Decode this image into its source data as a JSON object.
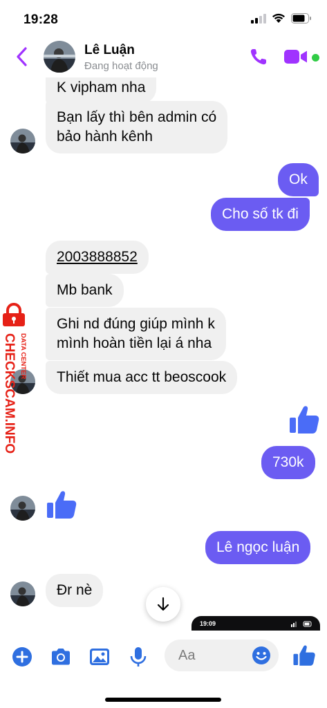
{
  "status_bar": {
    "time": "19:28"
  },
  "header": {
    "contact_name": "Lê Luận",
    "contact_status": "Đang hoạt động",
    "icons": [
      "back-chevron-icon",
      "phone-call-icon",
      "video-call-icon"
    ],
    "accent_color": "#a033ff"
  },
  "messages": {
    "in_1": "K vipham nha",
    "in_2_line1": "Bạn lấy thì bên admin có",
    "in_2_line2": "bảo hành kênh",
    "out_1": "Ok",
    "out_2": "Cho số tk đi",
    "in_3": "2003888852",
    "in_4": "Mb bank",
    "in_5_line1": "Ghi nd đúng giúp mình k",
    "in_5_line2": "mình hoàn tiền lại á nha",
    "in_6": "Thiết mua acc tt beoscook",
    "out_like": "thumbs-up-icon",
    "out_3": "730k",
    "in_like": "thumbs-up-icon",
    "out_4": "Lê ngọc luận",
    "in_7": "Đr nè"
  },
  "image_preview": {
    "time": "19:09"
  },
  "composer": {
    "placeholder": "Aa",
    "icons": [
      "plus-icon",
      "camera-icon",
      "gallery-icon",
      "microphone-icon",
      "emoji-icon",
      "thumbs-up-icon"
    ]
  },
  "watermark": {
    "site": "CHECKSCAM.INFO",
    "tag": "DATA CENTER"
  },
  "colors": {
    "outgoing_bubble": "#6b5cf2",
    "incoming_bubble": "#f0f0f0",
    "like_blue": "#4a6cf7",
    "watermark_red": "#e62117"
  }
}
